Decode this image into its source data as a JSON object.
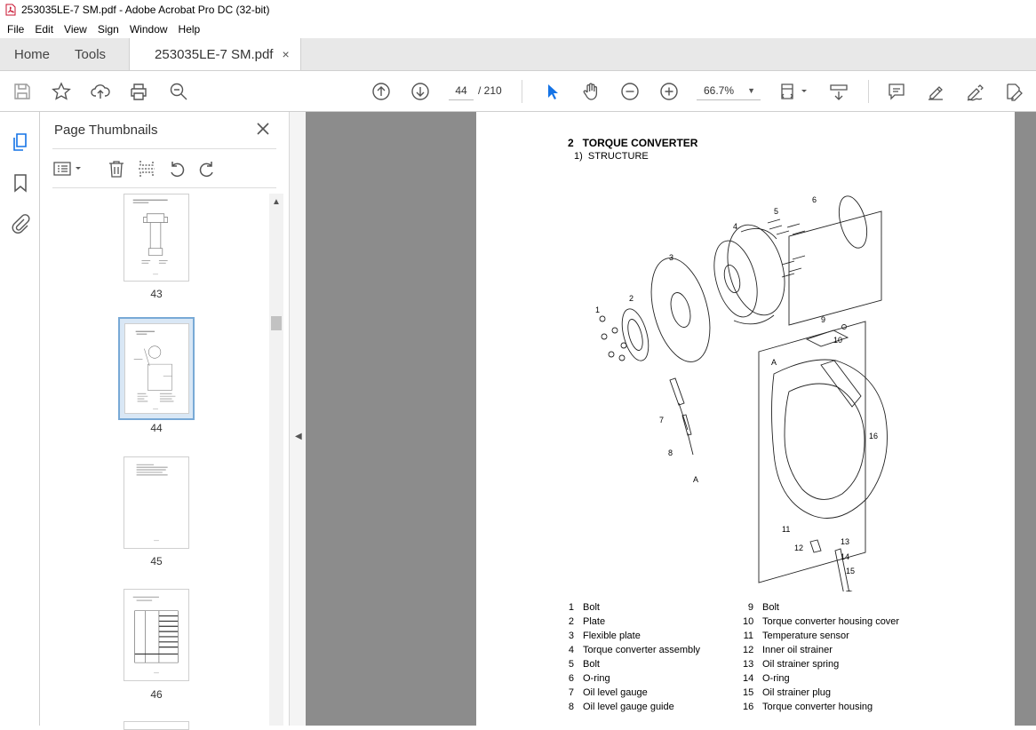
{
  "window": {
    "title": "253035LE-7 SM.pdf - Adobe Acrobat Pro DC (32-bit)"
  },
  "menu": [
    "File",
    "Edit",
    "View",
    "Sign",
    "Window",
    "Help"
  ],
  "tabs": {
    "home": "Home",
    "tools": "Tools",
    "doc": "253035LE-7 SM.pdf",
    "close": "×"
  },
  "toolbar": {
    "page_current": "44",
    "page_total": "/ 210",
    "zoom": "66.7%",
    "icons": [
      "save-icon",
      "bookmark-star-icon",
      "upload-icon",
      "print-icon",
      "zoom-search-icon",
      "prev-page-icon",
      "next-page-icon",
      "select-arrow-icon",
      "hand-icon",
      "zoom-out-icon",
      "zoom-in-icon",
      "fit-page-icon",
      "scroll-mode-icon",
      "comment-icon",
      "highlight-pen-icon",
      "sign-icon",
      "edit-pdf-icon"
    ]
  },
  "left_rail": {
    "icons": [
      "page-thumbnails-icon",
      "bookmarks-icon",
      "attachments-icon"
    ]
  },
  "thumbnails_panel": {
    "title": "Page Thumbnails",
    "pages": [
      {
        "label": "43"
      },
      {
        "label": "44",
        "selected": true
      },
      {
        "label": "45"
      },
      {
        "label": "46"
      }
    ]
  },
  "document": {
    "heading": "2   TORQUE CONVERTER",
    "subheading": "1)  STRUCTURE",
    "callouts": [
      "1",
      "2",
      "3",
      "4",
      "5",
      "6",
      "7",
      "8",
      "9",
      "10",
      "11",
      "12",
      "13",
      "14",
      "15",
      "16",
      "A",
      "A"
    ],
    "parts_left": [
      {
        "no": "1",
        "name": "Bolt"
      },
      {
        "no": "2",
        "name": "Plate"
      },
      {
        "no": "3",
        "name": "Flexible plate"
      },
      {
        "no": "4",
        "name": "Torque converter assembly"
      },
      {
        "no": "5",
        "name": "Bolt"
      },
      {
        "no": "6",
        "name": "O-ring"
      },
      {
        "no": "7",
        "name": "Oil level gauge"
      },
      {
        "no": "8",
        "name": "Oil level gauge guide"
      }
    ],
    "parts_right": [
      {
        "no": "9",
        "name": "Bolt"
      },
      {
        "no": "10",
        "name": "Torque converter housing cover"
      },
      {
        "no": "11",
        "name": "Temperature sensor"
      },
      {
        "no": "12",
        "name": "Inner oil strainer"
      },
      {
        "no": "13",
        "name": "Oil strainer spring"
      },
      {
        "no": "14",
        "name": "O-ring"
      },
      {
        "no": "15",
        "name": "Oil strainer plug"
      },
      {
        "no": "16",
        "name": "Torque converter housing"
      }
    ]
  }
}
